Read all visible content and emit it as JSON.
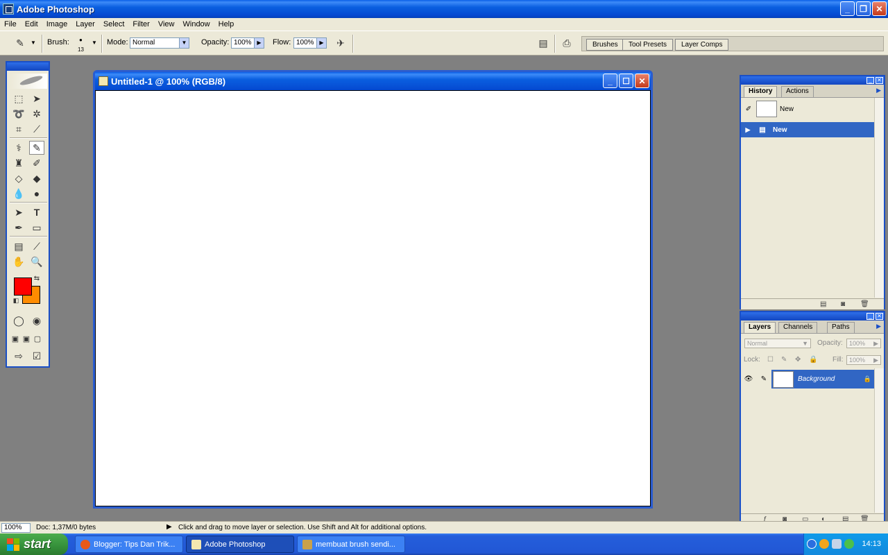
{
  "app": {
    "title": "Adobe Photoshop",
    "window_buttons": {
      "minimize": "_",
      "restore": "❐",
      "close": "✕"
    }
  },
  "menu": [
    "File",
    "Edit",
    "Image",
    "Layer",
    "Select",
    "Filter",
    "View",
    "Window",
    "Help"
  ],
  "options": {
    "brush_label": "Brush:",
    "brush_size": "13",
    "mode_label": "Mode:",
    "mode_value": "Normal",
    "opacity_label": "Opacity:",
    "opacity_value": "100%",
    "flow_label": "Flow:",
    "flow_value": "100%",
    "well_tabs": [
      "Brushes",
      "Tool Presets",
      "Layer Comps"
    ]
  },
  "colors": {
    "foreground": "#ff0000",
    "background": "#ff8c00"
  },
  "document": {
    "title": "Untitled-1 @ 100% (RGB/8)"
  },
  "history": {
    "tabs": [
      "History",
      "Actions"
    ],
    "snapshot_label": "New",
    "state_label": "New"
  },
  "layers": {
    "tabs": [
      "Layers",
      "Channels",
      "Paths"
    ],
    "blend_mode": "Normal",
    "opacity_label": "Opacity:",
    "opacity_value": "100%",
    "lock_label": "Lock:",
    "fill_label": "Fill:",
    "fill_value": "100%",
    "layer_name": "Background"
  },
  "status": {
    "zoom": "100%",
    "doc_info": "Doc: 1,37M/0 bytes",
    "hint": "Click and drag to move layer or selection.  Use Shift and Alt for additional options."
  },
  "taskbar": {
    "start_label": "start",
    "tasks": [
      "Blogger: Tips Dan Trik...",
      "Adobe Photoshop",
      "membuat brush sendi..."
    ],
    "clock": "14:13"
  }
}
